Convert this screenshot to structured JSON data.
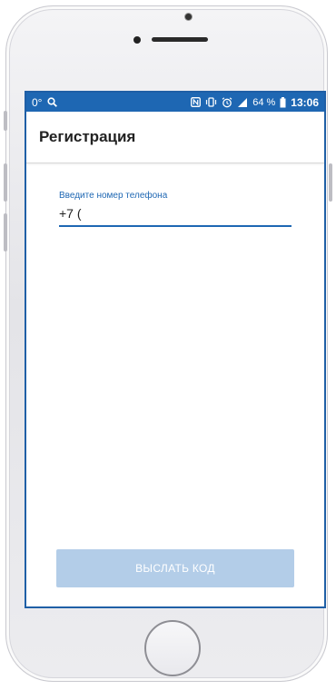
{
  "status_bar": {
    "temperature": "0°",
    "battery_percent": "64 %",
    "time": "13:06",
    "icons": [
      "search-icon",
      "nfc-icon",
      "vibrate-icon",
      "alarm-icon",
      "signal-icon",
      "battery-icon"
    ],
    "color": "#1e67b3"
  },
  "app_bar": {
    "title": "Регистрация"
  },
  "phone_form": {
    "label": "Введите номер телефона",
    "value": "+7 (",
    "accent_color": "#1e67b3"
  },
  "send_code_button": {
    "label": "ВЫСЛАТЬ КОД",
    "disabled_color": "#b3cde8"
  }
}
